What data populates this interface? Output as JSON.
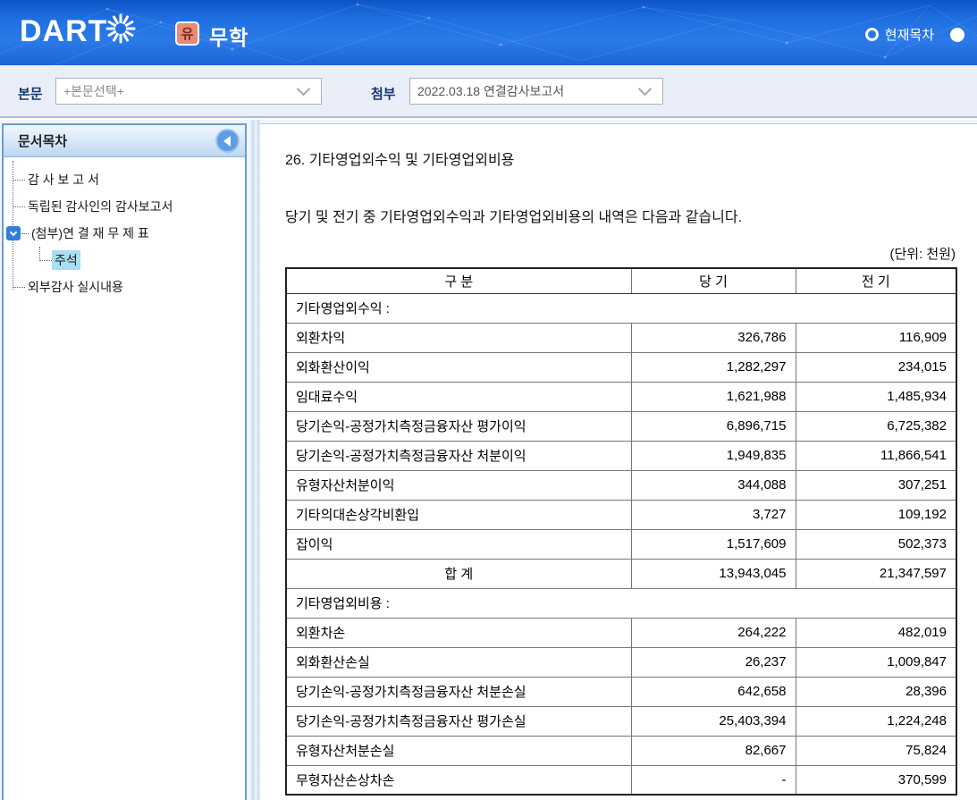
{
  "header": {
    "brand": "DART",
    "corp_badge": "유",
    "corp_name": "무학",
    "toc_radio_label": "현재목차"
  },
  "toolbar": {
    "body_label": "본문",
    "body_value": "+본문선택+",
    "attach_label": "첨부",
    "attach_value": "2022.03.18  연결감사보고서"
  },
  "sidebar": {
    "title": "문서목차",
    "items": [
      {
        "label": "감 사 보 고 서",
        "depth": 1,
        "expander": false,
        "selected": false
      },
      {
        "label": "독립된 감사인의 감사보고서",
        "depth": 1,
        "expander": false,
        "selected": false
      },
      {
        "label": "(첨부)연 결 재 무 제 표",
        "depth": 1,
        "expander": true,
        "selected": false
      },
      {
        "label": "주석",
        "depth": 2,
        "expander": false,
        "selected": true
      },
      {
        "label": "외부감사 실시내용",
        "depth": 1,
        "expander": false,
        "selected": false
      }
    ]
  },
  "content": {
    "title": "26. 기타영업외수익 및 기타영업외비용",
    "description": "당기 및 전기 중 기타영업외수익과 기타영업외비용의 내역은 다음과 같습니다.",
    "unit_note": "(단위: 천원)",
    "table": {
      "headers": [
        "구 분",
        "당 기",
        "전 기"
      ],
      "rows": [
        {
          "type": "section",
          "label": "기타영업외수익 :",
          "current": "",
          "previous": ""
        },
        {
          "type": "item",
          "label": "외환차익",
          "current": "326,786",
          "previous": "116,909"
        },
        {
          "type": "item",
          "label": "외화환산이익",
          "current": "1,282,297",
          "previous": "234,015"
        },
        {
          "type": "item",
          "label": "임대료수익",
          "current": "1,621,988",
          "previous": "1,485,934"
        },
        {
          "type": "item",
          "label": "당기손익-공정가치측정금융자산 평가이익",
          "current": "6,896,715",
          "previous": "6,725,382"
        },
        {
          "type": "item",
          "label": "당기손익-공정가치측정금융자산 처분이익",
          "current": "1,949,835",
          "previous": "11,866,541"
        },
        {
          "type": "item",
          "label": "유형자산처분이익",
          "current": "344,088",
          "previous": "307,251"
        },
        {
          "type": "item",
          "label": "기타의대손상각비환입",
          "current": "3,727",
          "previous": "109,192"
        },
        {
          "type": "item",
          "label": "잡이익",
          "current": "1,517,609",
          "previous": "502,373"
        },
        {
          "type": "total",
          "label": "합 계",
          "current": "13,943,045",
          "previous": "21,347,597"
        },
        {
          "type": "section",
          "label": "기타영업외비용 :",
          "current": "",
          "previous": ""
        },
        {
          "type": "item",
          "label": "외환차손",
          "current": "264,222",
          "previous": "482,019"
        },
        {
          "type": "item",
          "label": "외화환산손실",
          "current": "26,237",
          "previous": "1,009,847"
        },
        {
          "type": "item",
          "label": "당기손익-공정가치측정금융자산 처분손실",
          "current": "642,658",
          "previous": "28,396"
        },
        {
          "type": "item",
          "label": "당기손익-공정가치측정금융자산 평가손실",
          "current": "25,403,394",
          "previous": "1,224,248"
        },
        {
          "type": "item",
          "label": "유형자산처분손실",
          "current": "82,667",
          "previous": "75,824"
        },
        {
          "type": "item",
          "label": "무형자산손상차손",
          "current": "-",
          "previous": "370,599"
        }
      ]
    }
  },
  "colors": {
    "header_blue": "#2070e2",
    "toolbar_bg": "#e9eef8",
    "panel_border": "#6b9bd2",
    "selected_item_bg": "#a9def5",
    "badge_bg": "#e88a74",
    "expander_bg": "#2f7ed9"
  }
}
